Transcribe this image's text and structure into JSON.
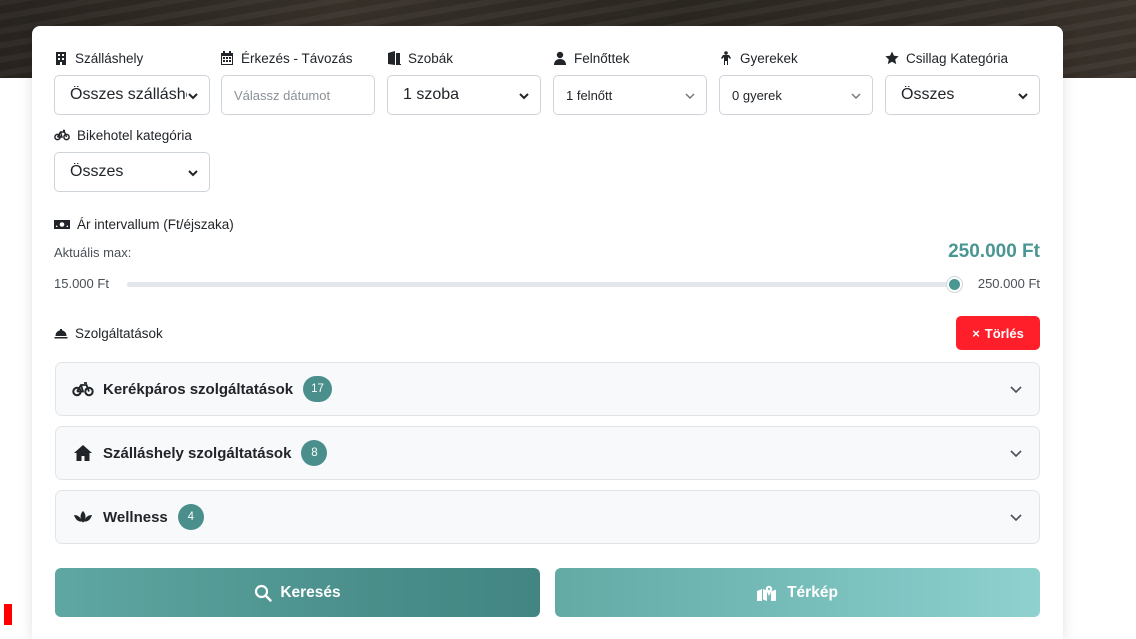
{
  "filters": {
    "accommodation": {
      "label": "Szálláshely",
      "value": "Összes szálláshely"
    },
    "dates": {
      "label": "Érkezés - Távozás",
      "placeholder": "Válassz dátumot"
    },
    "rooms": {
      "label": "Szobák",
      "value": "1 szoba"
    },
    "adults": {
      "label": "Felnőttek",
      "value": "1 felnőtt"
    },
    "children": {
      "label": "Gyerekek",
      "value": "0 gyerek"
    },
    "stars": {
      "label": "Csillag Kategória",
      "value": "Összes"
    },
    "bikehotel": {
      "label": "Bikehotel kategória",
      "value": "Összes"
    }
  },
  "price": {
    "label": "Ár intervallum (Ft/éjszaka)",
    "current_max_label": "Aktuális max:",
    "current_max_value": "250.000 Ft",
    "min_label": "15.000 Ft",
    "max_label": "250.000 Ft",
    "slider_min": 15000,
    "slider_max": 250000,
    "slider_value": 250000
  },
  "services": {
    "label": "Szolgáltatások",
    "clear_label": "Törlés",
    "clear_icon": "×",
    "groups": [
      {
        "title": "Kerékpáros szolgáltatások",
        "count": "17",
        "icon": "bicycle-icon"
      },
      {
        "title": "Szálláshely szolgáltatások",
        "count": "8",
        "icon": "home-icon"
      },
      {
        "title": "Wellness",
        "count": "4",
        "icon": "spa-icon"
      }
    ]
  },
  "actions": {
    "search_label": "Keresés",
    "map_label": "Térkép"
  },
  "colors": {
    "accent": "#4a9692",
    "badge": "#4a8f8c",
    "danger": "#ff1f2b"
  }
}
